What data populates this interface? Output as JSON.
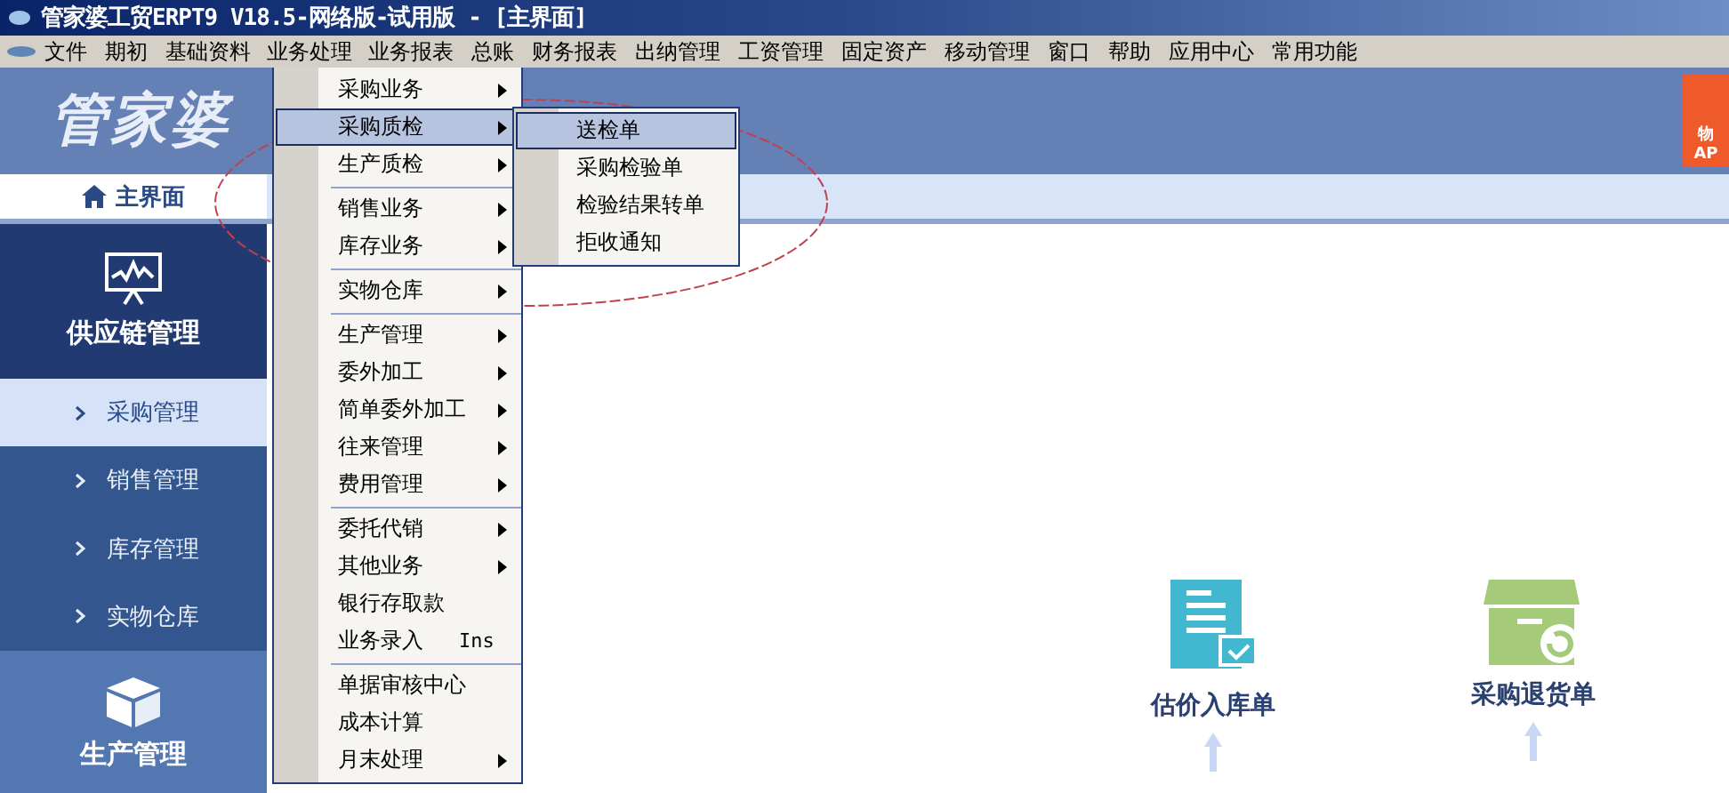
{
  "window": {
    "title": "管家婆工贸ERPT9 V18.5-网络版-试用版 - [主界面]"
  },
  "menu_bar": [
    {
      "label": "文件",
      "selected": false
    },
    {
      "label": "期初",
      "selected": false
    },
    {
      "label": "基础资料",
      "selected": false
    },
    {
      "label": "业务处理",
      "selected": true
    },
    {
      "label": "业务报表",
      "selected": false
    },
    {
      "label": "总账",
      "selected": false
    },
    {
      "label": "财务报表",
      "selected": false
    },
    {
      "label": "出纳管理",
      "selected": false
    },
    {
      "label": "工资管理",
      "selected": false
    },
    {
      "label": "固定资产",
      "selected": false
    },
    {
      "label": "移动管理",
      "selected": false
    },
    {
      "label": "窗口",
      "selected": false
    },
    {
      "label": "帮助",
      "selected": false
    },
    {
      "label": "应用中心",
      "selected": false
    },
    {
      "label": "常用功能",
      "selected": false
    }
  ],
  "banner": {
    "logo": "管家婆",
    "badge": [
      "物",
      "AP"
    ]
  },
  "tabs": [
    {
      "label": "主界面",
      "selected": true
    }
  ],
  "sidebar": {
    "module": "供应链管理",
    "items": [
      {
        "label": "采购管理",
        "selected": true
      },
      {
        "label": "销售管理",
        "selected": false
      },
      {
        "label": "库存管理",
        "selected": false
      },
      {
        "label": "实物仓库",
        "selected": false
      }
    ],
    "next_module": "生产管理"
  },
  "dropdown": [
    {
      "kind": "item",
      "label": "采购业务",
      "submenu": true,
      "selected": false
    },
    {
      "kind": "item",
      "label": "采购质检",
      "submenu": true,
      "selected": true
    },
    {
      "kind": "item",
      "label": "生产质检",
      "submenu": true,
      "selected": false
    },
    {
      "kind": "separator"
    },
    {
      "kind": "item",
      "label": "销售业务",
      "submenu": true,
      "selected": false
    },
    {
      "kind": "item",
      "label": "库存业务",
      "submenu": true,
      "selected": false
    },
    {
      "kind": "separator"
    },
    {
      "kind": "item",
      "label": "实物仓库",
      "submenu": true,
      "selected": false
    },
    {
      "kind": "separator"
    },
    {
      "kind": "item",
      "label": "生产管理",
      "submenu": true,
      "selected": false
    },
    {
      "kind": "item",
      "label": "委外加工",
      "submenu": true,
      "selected": false
    },
    {
      "kind": "item",
      "label": "简单委外加工",
      "submenu": true,
      "selected": false
    },
    {
      "kind": "item",
      "label": "往来管理",
      "submenu": true,
      "selected": false
    },
    {
      "kind": "item",
      "label": "费用管理",
      "submenu": true,
      "selected": false
    },
    {
      "kind": "separator"
    },
    {
      "kind": "item",
      "label": "委托代销",
      "submenu": true,
      "selected": false
    },
    {
      "kind": "item",
      "label": "其他业务",
      "submenu": true,
      "selected": false
    },
    {
      "kind": "item",
      "label": "银行存取款",
      "submenu": false,
      "selected": false
    },
    {
      "kind": "item",
      "label": "业务录入",
      "shortcut": "Ins",
      "submenu": false,
      "selected": false
    },
    {
      "kind": "separator"
    },
    {
      "kind": "item",
      "label": "单据审核中心",
      "submenu": false,
      "selected": false
    },
    {
      "kind": "item",
      "label": "成本计算",
      "submenu": false,
      "selected": false
    },
    {
      "kind": "item",
      "label": "月末处理",
      "submenu": true,
      "selected": false
    }
  ],
  "submenu": [
    {
      "label": "送检单",
      "selected": true
    },
    {
      "label": "采购检验单",
      "selected": false
    },
    {
      "label": "检验结果转单",
      "selected": false
    },
    {
      "label": "拒收通知",
      "selected": false
    }
  ],
  "flow": [
    {
      "label": "估价入库单",
      "kind": "document"
    },
    {
      "label": "采购退货单",
      "kind": "return-box"
    }
  ]
}
